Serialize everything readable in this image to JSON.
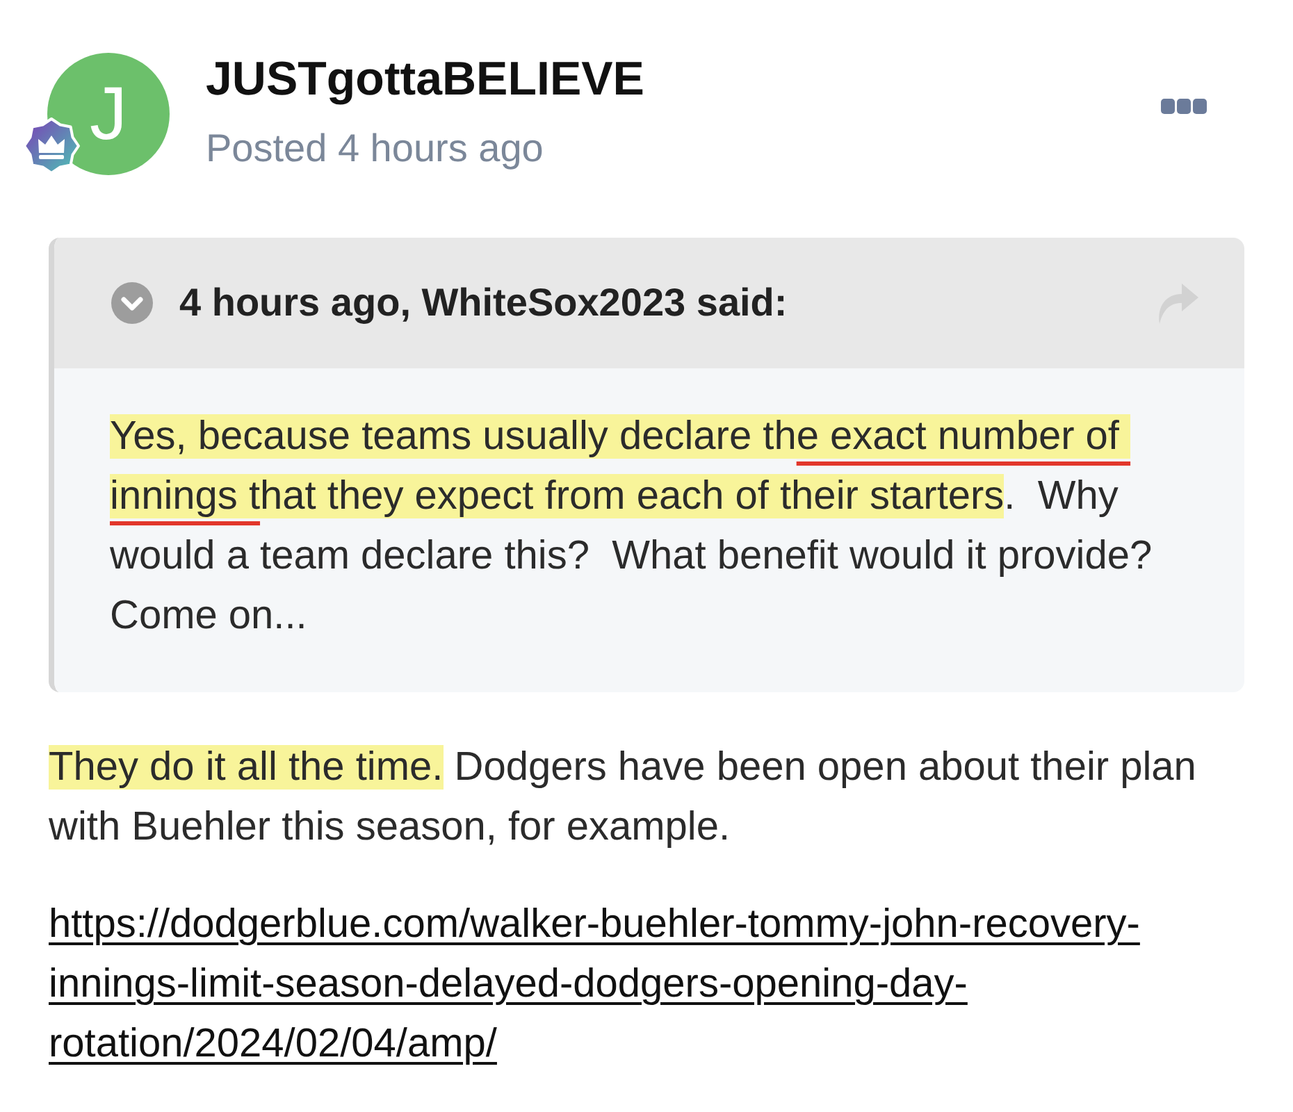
{
  "post": {
    "avatar_letter": "J",
    "author": "JUSTgottaBELIEVE",
    "meta": "Posted 4 hours ago"
  },
  "quote": {
    "header": "4 hours ago, WhiteSox2023 said:",
    "body": [
      {
        "text": "Yes, because teams usually declare th",
        "highlighted": true,
        "underlined": false
      },
      {
        "text": "e exact number of innings t",
        "highlighted": true,
        "underlined": true
      },
      {
        "text": "hat they expect from each of their starters",
        "highlighted": true,
        "underlined": false
      },
      {
        "text": ".  Why would a team declare this?  What benefit would it provide? Come on...",
        "highlighted": false,
        "underlined": false
      }
    ]
  },
  "reply": {
    "paragraphs": [
      [
        {
          "text": "They do it all the time.",
          "highlighted": true
        },
        {
          "text": " Dodgers have been open about their plan with Buehler this season, for example.",
          "highlighted": false
        }
      ]
    ],
    "link": "https://dodgerblue.com/walker-buehler-tommy-john-recovery-innings-limit-season-delayed-dodgers-opening-day-rotation/2024/02/04/amp/"
  }
}
